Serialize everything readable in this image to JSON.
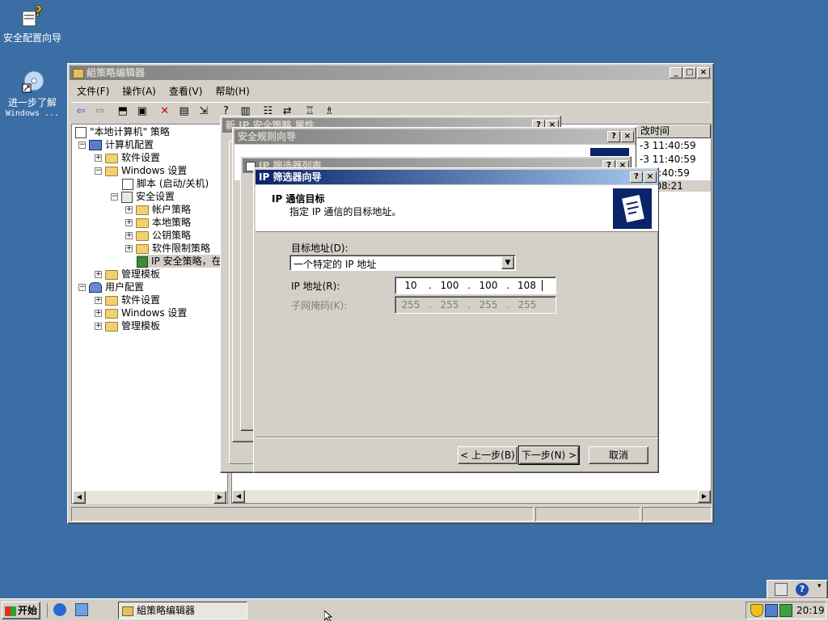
{
  "desktop": {
    "icons": [
      {
        "label": "安全配置向导"
      },
      {
        "label": "进一步了解",
        "label2": "Windows ..."
      }
    ]
  },
  "gpedit": {
    "title": "組策略编辑器",
    "menu": [
      "文件(F)",
      "操作(A)",
      "查看(V)",
      "帮助(H)"
    ],
    "tree": {
      "root": "\"本地计算机\" 策略",
      "computer_config": "计算机配置",
      "software_settings": "软件设置",
      "windows_settings": "Windows 设置",
      "scripts": "脚本 (启动/关机)",
      "security_settings": "安全设置",
      "account_policy": "帐户策略",
      "local_policy": "本地策略",
      "public_key_policy": "公钥策略",
      "software_restriction": "软件限制策略",
      "ip_security": "IP 安全策略，在",
      "admin_templates": "管理模板",
      "user_config": "用户配置",
      "user_software_settings": "软件设置",
      "user_windows_settings": "Windows 设置",
      "user_admin_templates": "管理模板"
    },
    "right_pane": {
      "column_header": "改时间",
      "times": [
        "-3 11:40:59",
        "-3 11:40:59",
        "11:40:59",
        "20:08:21"
      ]
    }
  },
  "dialogs": {
    "ip_policy_props_title": "新 IP 安全策略 属性",
    "rule_wizard_title": "安全规则向导",
    "rule_wizard_partial": "IP 筛选器列表",
    "filter_list_title": "IP 筛选器列表"
  },
  "wizard": {
    "title": "IP 筛选器向导",
    "heading": "IP 通信目标",
    "subheading": "指定 IP 通信的目标地址。",
    "dest_label": "目标地址(D):",
    "dest_value": "一个特定的 IP 地址",
    "ip_label": "IP 地址(R):",
    "ip_octets": [
      "10",
      "100",
      "100",
      "108"
    ],
    "mask_label": "子网掩码(K):",
    "mask_octets": [
      "255",
      "255",
      "255",
      "255"
    ],
    "back_label": "< 上一步(B)",
    "next_label": "下一步(N) >",
    "cancel_label": "取消"
  },
  "taskbar": {
    "start_label": "开始",
    "task_label": "組策略编辑器",
    "clock": "20:19"
  }
}
